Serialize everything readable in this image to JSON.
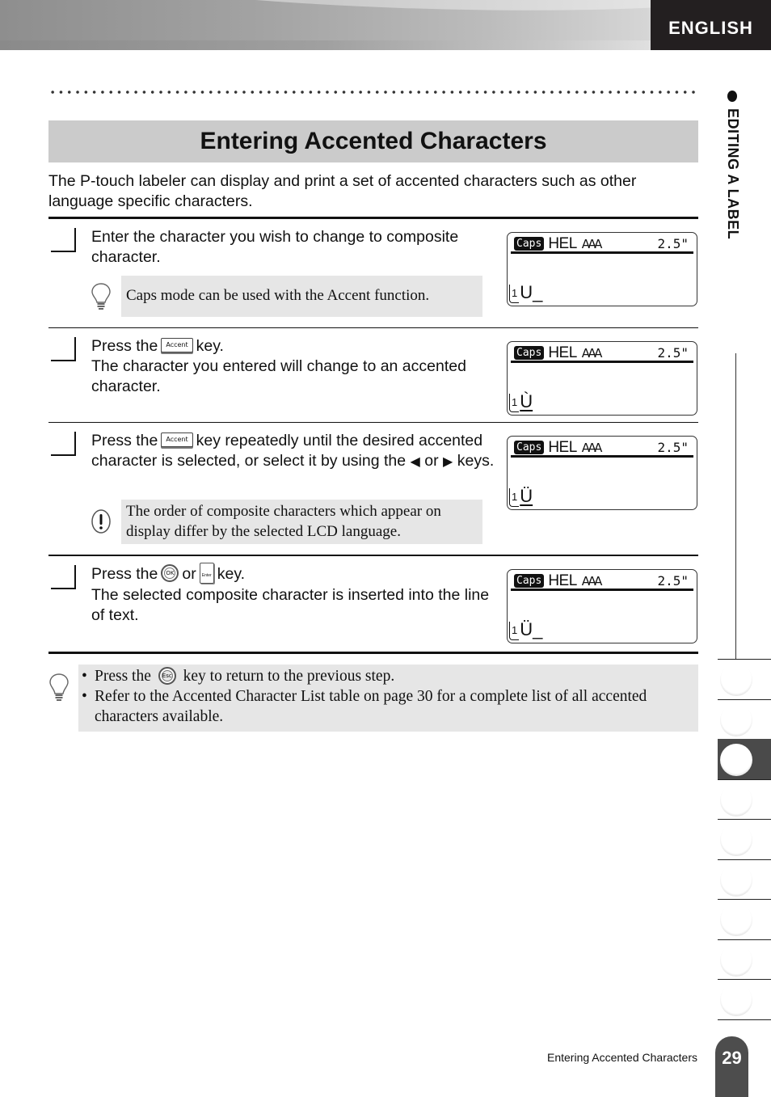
{
  "header": {
    "language_tab": "ENGLISH"
  },
  "sidebar": {
    "chapter_label": "EDITING A LABEL",
    "chapter_tabs": [
      {
        "index": 1,
        "active": false
      },
      {
        "index": 2,
        "active": false
      },
      {
        "index": 3,
        "active": true
      },
      {
        "index": 4,
        "active": false
      },
      {
        "index": 5,
        "active": false
      },
      {
        "index": 6,
        "active": false
      },
      {
        "index": 7,
        "active": false
      },
      {
        "index": 8,
        "active": false
      },
      {
        "index": 9,
        "active": false
      }
    ]
  },
  "page": {
    "title": "Entering Accented Characters",
    "intro": "The P-touch labeler can display and print a set of accented characters such as other language specific characters."
  },
  "steps": [
    {
      "text_lines": [
        "Enter the character you wish to change to composite character."
      ],
      "note": {
        "type": "hint",
        "text": "Caps mode can be used with the Accent function."
      },
      "lcd": {
        "caps": "Caps",
        "font": "HEL",
        "size_icon": "AAA",
        "length": "2.5\"",
        "line_no": "1",
        "char": "U",
        "char_underlined": false,
        "cursor": "_"
      }
    },
    {
      "press_prefix": "Press the",
      "key": "Accent",
      "press_suffix": "key.",
      "text_after": "The character you entered will change to an accented character.",
      "lcd": {
        "caps": "Caps",
        "font": "HEL",
        "size_icon": "AAA",
        "length": "2.5\"",
        "line_no": "1",
        "char": "Ù",
        "char_underlined": true,
        "cursor": ""
      }
    },
    {
      "press_prefix": "Press the",
      "key": "Accent",
      "press_suffix": "key repeatedly until the desired accented character is selected, or select it by using the",
      "left_key": "◀",
      "or_label": "or",
      "right_key": "▶",
      "keys_suffix": "keys.",
      "note": {
        "type": "caution",
        "text": "The order of composite characters which appear on display differ by the selected LCD language."
      },
      "lcd": {
        "caps": "Caps",
        "font": "HEL",
        "size_icon": "AAA",
        "length": "2.5\"",
        "line_no": "1",
        "char": "Ü",
        "char_underlined": true,
        "cursor": ""
      }
    },
    {
      "press_prefix": "Press the",
      "ok_key": "OK",
      "or_label": "or",
      "enter_key": "Enter",
      "press_suffix": "key.",
      "text_after": "The selected composite character is inserted into the line of text.",
      "lcd": {
        "caps": "Caps",
        "font": "HEL",
        "size_icon": "AAA",
        "length": "2.5\"",
        "line_no": "1",
        "char": "Ü",
        "char_underlined": false,
        "cursor": "_"
      }
    }
  ],
  "hints": {
    "items": [
      {
        "prefix": "Press the",
        "key": "Esc",
        "suffix": "key to return to the previous step."
      },
      {
        "text": "Refer to the Accented Character List table on page 30 for a complete list of all accented characters available."
      }
    ]
  },
  "footer": {
    "section_title": "Entering Accented Characters",
    "page_number": "29"
  }
}
